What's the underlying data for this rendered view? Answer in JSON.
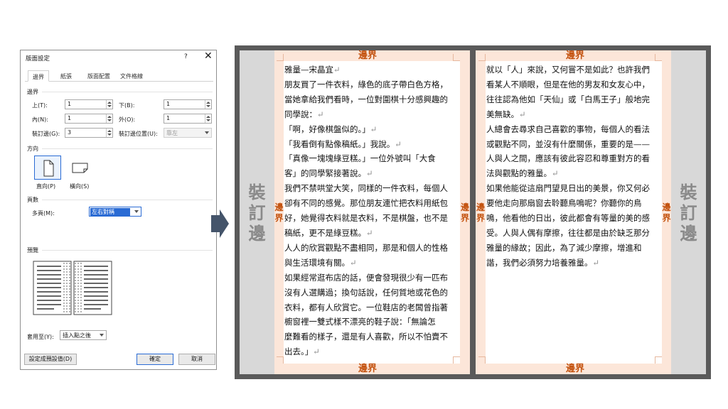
{
  "dialog": {
    "title": "版面設定",
    "help": "?",
    "close": "✕",
    "tabs": [
      "邊界",
      "紙張",
      "版面配置",
      "文件格線"
    ],
    "margins_section": "邊界",
    "top_label": "上(T):",
    "top_value": "1",
    "bottom_label": "下(B):",
    "bottom_value": "1",
    "inner_label": "內(N):",
    "inner_value": "1",
    "outer_label": "外(O):",
    "outer_value": "1",
    "gutter_label": "裝訂邊(G):",
    "gutter_value": "3",
    "gutter_pos_label": "裝訂邊位置(U):",
    "gutter_pos_value": "靠左",
    "orientation_section": "方向",
    "portrait": "直向(P)",
    "landscape": "橫向(S)",
    "pages_section": "頁數",
    "multiple_pages_label": "多頁(M):",
    "multiple_pages_value": "左右對稱",
    "preview_section": "預覽",
    "apply_to_label": "套用至(Y):",
    "apply_to_value": "插入點之後",
    "set_default": "設定成預設值(D)",
    "ok": "確定",
    "cancel": "取消"
  },
  "illustration": {
    "binding_label": "裝訂邊",
    "margin_label": "邊界",
    "left_page_lines": [
      "雅量—宋晶宜↵",
      "朋友買了一件衣料，綠色的底子帶白色方格，",
      "當她拿給我們看時，一位對圍棋十分感興趣的",
      "同學說：↵",
      "「啊，好像棋盤似的。」↵",
      "「我看倒有點像稿紙。」我說。↵",
      "「真像一塊塊綠豆糕。」一位外號叫「大食",
      "客」的同學緊接著說。↵",
      "我們不禁哄堂大笑，同樣的一件衣料，每個人",
      "卻有不同的感覺。那位朋友連忙把衣料用紙包",
      "好，她覺得衣料就是衣料，不是棋盤，也不是",
      "稿紙，更不是綠豆糕。↵",
      "人人的欣賞觀點不盡相同，那是和個人的性格",
      "與生活環境有關。↵",
      "如果經常逛布店的話，便會發現很少有一匹布",
      "沒有人選購過；換句話說，任何質地或花色的",
      "衣料，都有人欣賞它。一位鞋店的老闆曾指著",
      "櫥窗裡一雙式樣不漂亮的鞋子說：「無論怎",
      "麼難看的樣子，還是有人喜歡，所以不怕賣不",
      "出去。」↵"
    ],
    "right_page_lines": [
      "就以「人」來說，又何嘗不是如此？也許我們",
      "看某人不順眼，但是在他的男友和女友心中，",
      "往往認為他如「天仙」或「白馬王子」般地完",
      "美無缺。↵",
      "人總會去尋求自己喜歡的事物，每個人的看法",
      "或觀點不同，並沒有什麼關係，重要的是——",
      "人與人之間，應該有彼此容忍和尊重對方的看",
      "法與觀點的雅量。↵",
      "如果他能從這扇門望見日出的美景，你又何必",
      "要他走向那扇窗去聆聽鳥鳴呢？你聽你的鳥",
      "鳴，他看他的日出，彼此都會有等量的美的感",
      "受。人與人偶有摩擦，往往都是由於缺乏那分",
      "雅量的緣故；因此，為了減少摩擦，增進和",
      "諧，我們必須努力培養雅量。↵"
    ]
  },
  "colors": {
    "accent": "#2a6bd4",
    "margin_fill": "#fce6d9",
    "margin_text": "#c45411",
    "binding_fill": "#d8d8d8",
    "frame": "#5a5a5a",
    "arrow": "#44546a"
  }
}
